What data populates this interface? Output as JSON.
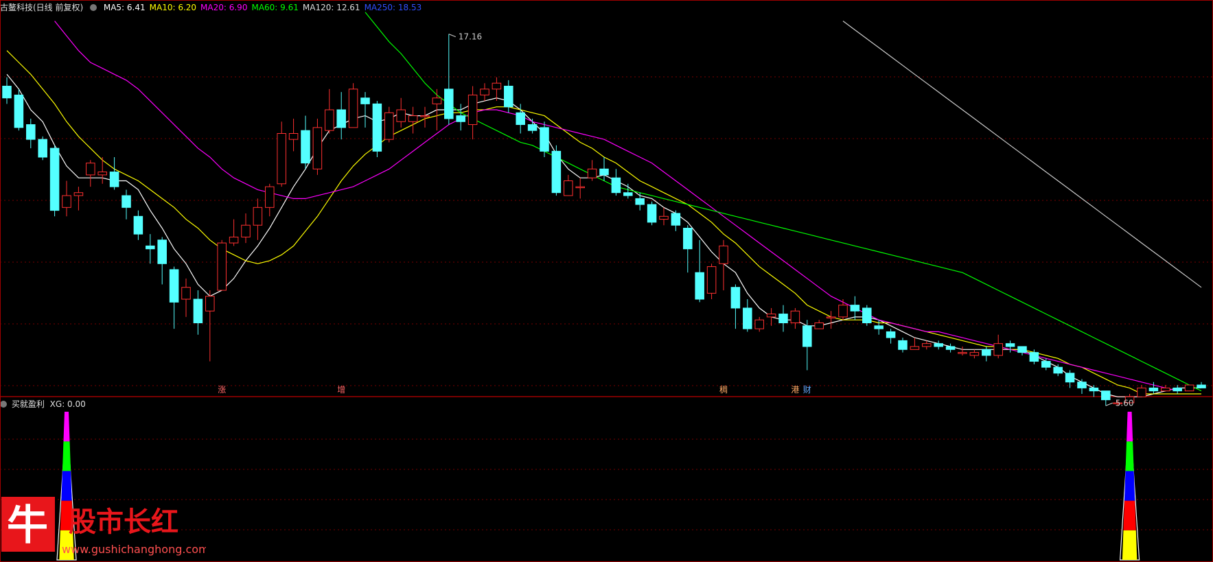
{
  "header": {
    "stock_name": "古鳌科技(日线 前复权)",
    "ma_labels": [
      {
        "text": "MA5: 6.41",
        "color": "#ffffff"
      },
      {
        "text": "MA10: 6.20",
        "color": "#ffff00"
      },
      {
        "text": "MA20: 6.90",
        "color": "#ff00ff"
      },
      {
        "text": "MA60: 9.61",
        "color": "#00ff00"
      },
      {
        "text": "MA120: 12.61",
        "color": "#dddddd"
      },
      {
        "text": "MA250: 18.53",
        "color": "#3050ff"
      }
    ]
  },
  "sub_header": {
    "indicator": "买就盈利",
    "value_label": "XG: 0.00"
  },
  "markers": [
    {
      "text": "涨",
      "x_index": 18,
      "color": "#ff6666"
    },
    {
      "text": "增",
      "x_index": 28,
      "color": "#ff6666"
    },
    {
      "text": "稠",
      "x_index": 60,
      "color": "#ffaa66"
    },
    {
      "text": "港",
      "x_index": 66,
      "color": "#ffaa66"
    },
    {
      "text": "财",
      "x_index": 67,
      "color": "#66aaff"
    }
  ],
  "watermark": {
    "big_char": "牛",
    "title": "股市长红",
    "url": "www.gushichanghong.com"
  },
  "colors": {
    "up": "#ff3030",
    "down": "#54ffff",
    "grid": "#7a0000",
    "border": "#a00000"
  },
  "chart_data": {
    "type": "candlestick",
    "price_max_label": "17.16",
    "price_min_label": "5.60",
    "ylim": [
      5.0,
      17.8
    ],
    "candles": [
      [
        15.4,
        15.0,
        15.7,
        14.8
      ],
      [
        15.1,
        14.0,
        15.3,
        13.9
      ],
      [
        14.1,
        13.6,
        14.3,
        13.3
      ],
      [
        13.6,
        13.0,
        13.7,
        12.9
      ],
      [
        13.3,
        11.2,
        13.4,
        11.0
      ],
      [
        11.3,
        11.7,
        12.2,
        11.0
      ],
      [
        11.7,
        11.8,
        12.0,
        11.2
      ],
      [
        12.4,
        12.8,
        12.9,
        12.0
      ],
      [
        12.4,
        12.5,
        13.0,
        12.1
      ],
      [
        12.5,
        12.0,
        13.0,
        11.9
      ],
      [
        11.7,
        11.3,
        11.9,
        10.9
      ],
      [
        11.0,
        10.4,
        11.2,
        10.2
      ],
      [
        10.0,
        9.9,
        10.4,
        9.4
      ],
      [
        10.2,
        9.4,
        10.3,
        8.7
      ],
      [
        9.2,
        8.1,
        9.3,
        7.2
      ],
      [
        8.2,
        8.6,
        8.9,
        7.6
      ],
      [
        8.2,
        7.4,
        8.5,
        7.0
      ],
      [
        7.8,
        8.3,
        8.5,
        6.1
      ],
      [
        8.5,
        10.1,
        10.2,
        8.5
      ],
      [
        10.1,
        10.3,
        10.9,
        10.0
      ],
      [
        10.3,
        10.7,
        11.1,
        10.1
      ],
      [
        10.7,
        11.3,
        11.6,
        10.2
      ],
      [
        11.3,
        12.0,
        12.1,
        11.0
      ],
      [
        12.1,
        13.8,
        14.2,
        12.0
      ],
      [
        13.6,
        13.8,
        14.3,
        13.2
      ],
      [
        13.9,
        12.8,
        14.4,
        12.6
      ],
      [
        12.6,
        14.0,
        14.3,
        12.4
      ],
      [
        13.9,
        14.6,
        15.3,
        13.8
      ],
      [
        14.6,
        14.0,
        15.2,
        13.6
      ],
      [
        14.0,
        15.3,
        15.5,
        14.0
      ],
      [
        15.0,
        14.8,
        15.2,
        14.0
      ],
      [
        14.8,
        13.2,
        14.9,
        13.0
      ],
      [
        13.6,
        14.5,
        14.7,
        13.5
      ],
      [
        14.2,
        14.6,
        15.0,
        14.0
      ],
      [
        14.2,
        14.4,
        14.7,
        13.8
      ],
      [
        14.4,
        14.4,
        14.7,
        14.0
      ],
      [
        14.8,
        15.0,
        15.3,
        13.9
      ],
      [
        15.3,
        14.3,
        17.16,
        14.1
      ],
      [
        14.4,
        14.2,
        14.8,
        13.9
      ],
      [
        14.1,
        15.1,
        15.4,
        13.6
      ],
      [
        15.1,
        15.3,
        15.5,
        14.9
      ],
      [
        15.3,
        15.5,
        15.7,
        14.9
      ],
      [
        15.4,
        14.7,
        15.6,
        14.5
      ],
      [
        14.5,
        14.1,
        14.8,
        13.8
      ],
      [
        14.1,
        13.9,
        14.3,
        13.8
      ],
      [
        14.0,
        13.2,
        14.2,
        13.0
      ],
      [
        13.2,
        11.8,
        13.4,
        11.7
      ],
      [
        11.7,
        12.2,
        12.4,
        11.7
      ],
      [
        12.0,
        12.0,
        12.3,
        11.6
      ],
      [
        12.3,
        12.6,
        12.9,
        12.2
      ],
      [
        12.6,
        12.4,
        13.0,
        12.2
      ],
      [
        12.3,
        11.8,
        12.6,
        11.7
      ],
      [
        11.8,
        11.7,
        12.1,
        11.6
      ],
      [
        11.6,
        11.4,
        11.8,
        11.2
      ],
      [
        11.4,
        10.8,
        11.5,
        10.7
      ],
      [
        10.9,
        11.0,
        11.3,
        10.7
      ],
      [
        11.1,
        10.7,
        11.2,
        10.5
      ],
      [
        10.6,
        9.9,
        10.7,
        9.1
      ],
      [
        9.1,
        8.2,
        10.2,
        8.1
      ],
      [
        8.4,
        9.3,
        9.4,
        8.2
      ],
      [
        9.4,
        10.0,
        10.2,
        8.5
      ],
      [
        8.6,
        7.9,
        8.7,
        7.2
      ],
      [
        7.9,
        7.2,
        8.2,
        7.1
      ],
      [
        7.2,
        7.5,
        7.6,
        7.1
      ],
      [
        7.6,
        7.7,
        7.9,
        7.3
      ],
      [
        7.7,
        7.4,
        8.0,
        7.1
      ],
      [
        7.4,
        7.8,
        7.9,
        7.2
      ],
      [
        7.3,
        6.6,
        7.5,
        5.8
      ],
      [
        7.2,
        7.4,
        7.5,
        7.2
      ],
      [
        7.6,
        7.6,
        7.8,
        7.2
      ],
      [
        7.6,
        8.0,
        8.2,
        7.5
      ],
      [
        8.0,
        7.8,
        8.3,
        7.5
      ],
      [
        7.9,
        7.4,
        8.0,
        7.3
      ],
      [
        7.3,
        7.2,
        7.5,
        7.0
      ],
      [
        7.1,
        6.9,
        7.2,
        6.7
      ],
      [
        6.8,
        6.5,
        6.9,
        6.4
      ],
      [
        6.5,
        6.6,
        6.9,
        6.5
      ],
      [
        6.6,
        6.7,
        6.8,
        6.5
      ],
      [
        6.7,
        6.6,
        6.8,
        6.5
      ],
      [
        6.6,
        6.5,
        6.7,
        6.4
      ],
      [
        6.4,
        6.4,
        6.6,
        6.3
      ],
      [
        6.3,
        6.4,
        6.5,
        6.2
      ],
      [
        6.5,
        6.3,
        6.6,
        6.1
      ],
      [
        6.3,
        6.7,
        7.0,
        6.2
      ],
      [
        6.7,
        6.6,
        6.8,
        6.4
      ],
      [
        6.6,
        6.4,
        6.6,
        6.3
      ],
      [
        6.4,
        6.1,
        6.5,
        6.0
      ],
      [
        6.1,
        5.9,
        6.2,
        5.8
      ],
      [
        5.9,
        5.7,
        6.0,
        5.6
      ],
      [
        5.7,
        5.4,
        5.8,
        5.2
      ],
      [
        5.4,
        5.2,
        5.5,
        5.0
      ],
      [
        5.2,
        5.1,
        5.3,
        4.9
      ],
      [
        5.1,
        4.8,
        5.1,
        4.6
      ],
      [
        4.7,
        4.7,
        4.8,
        4.6
      ],
      [
        4.7,
        4.9,
        5.0,
        4.7
      ],
      [
        4.9,
        5.2,
        5.3,
        4.9
      ],
      [
        5.2,
        5.1,
        5.4,
        5.0
      ],
      [
        5.1,
        5.2,
        5.3,
        5.1
      ],
      [
        5.2,
        5.1,
        5.3,
        5.0
      ],
      [
        5.1,
        5.3,
        5.3,
        5.1
      ],
      [
        5.3,
        5.2,
        5.4,
        5.2
      ]
    ],
    "series": [
      {
        "name": "MA5",
        "color": "#ffffff",
        "from": 0,
        "values": [
          15.8,
          15.3,
          14.6,
          14.2,
          13.4,
          12.7,
          12.3,
          12.3,
          12.3,
          12.2,
          12.2,
          11.9,
          11.2,
          10.6,
          9.9,
          9.4,
          8.7,
          8.3,
          8.5,
          8.9,
          9.5,
          10.0,
          10.6,
          11.3,
          12.0,
          12.6,
          13.3,
          13.9,
          14.1,
          14.3,
          14.4,
          14.2,
          14.3,
          14.5,
          14.4,
          14.4,
          14.6,
          14.6,
          14.6,
          14.8,
          14.9,
          15.0,
          14.9,
          14.6,
          14.2,
          13.8,
          13.1,
          12.6,
          12.3,
          12.3,
          12.4,
          12.2,
          12.0,
          11.7,
          11.6,
          11.3,
          11.1,
          10.8,
          10.3,
          9.8,
          9.4,
          9.1,
          8.4,
          7.9,
          7.6,
          7.5,
          7.5,
          7.3,
          7.3,
          7.4,
          7.5,
          7.6,
          7.6,
          7.5,
          7.3,
          7.1,
          6.9,
          6.8,
          6.7,
          6.6,
          6.5,
          6.5,
          6.5,
          6.5,
          6.5,
          6.5,
          6.3,
          6.1,
          5.9,
          5.6,
          5.4,
          5.2,
          5.0,
          4.9,
          4.9,
          4.9,
          5.0,
          5.1,
          5.2,
          5.2,
          5.2
        ]
      },
      {
        "name": "MA10",
        "color": "#ffff00",
        "from": 0,
        "values": [
          16.6,
          16.2,
          15.8,
          15.3,
          14.8,
          14.2,
          13.7,
          13.3,
          12.9,
          12.6,
          12.4,
          12.2,
          11.9,
          11.6,
          11.3,
          10.9,
          10.6,
          10.2,
          9.9,
          9.7,
          9.5,
          9.4,
          9.5,
          9.7,
          10.0,
          10.5,
          11.0,
          11.6,
          12.2,
          12.7,
          13.1,
          13.4,
          13.7,
          13.9,
          14.1,
          14.3,
          14.4,
          14.5,
          14.5,
          14.6,
          14.6,
          14.7,
          14.7,
          14.6,
          14.5,
          14.4,
          14.1,
          13.8,
          13.5,
          13.3,
          13.0,
          12.8,
          12.5,
          12.2,
          12.0,
          11.8,
          11.6,
          11.4,
          11.1,
          10.8,
          10.4,
          10.1,
          9.7,
          9.3,
          9.0,
          8.7,
          8.4,
          8.0,
          7.8,
          7.6,
          7.5,
          7.5,
          7.5,
          7.4,
          7.4,
          7.3,
          7.2,
          7.1,
          7.0,
          6.9,
          6.8,
          6.7,
          6.6,
          6.6,
          6.5,
          6.5,
          6.4,
          6.3,
          6.2,
          6.0,
          5.9,
          5.7,
          5.5,
          5.3,
          5.2,
          5.0,
          5.0,
          5.0,
          5.0,
          5.0,
          5.0
        ]
      },
      {
        "name": "MA20",
        "color": "#ff00ff",
        "from": 4,
        "values": [
          17.6,
          17.1,
          16.6,
          16.2,
          16.0,
          15.8,
          15.6,
          15.3,
          14.9,
          14.5,
          14.1,
          13.7,
          13.3,
          13.0,
          12.6,
          12.3,
          12.1,
          11.9,
          11.8,
          11.7,
          11.6,
          11.6,
          11.7,
          11.8,
          11.9,
          12.0,
          12.2,
          12.4,
          12.6,
          12.9,
          13.2,
          13.5,
          13.8,
          14.1,
          14.3,
          14.5,
          14.6,
          14.6,
          14.5,
          14.4,
          14.2,
          14.1,
          14.0,
          13.9,
          13.8,
          13.7,
          13.6,
          13.4,
          13.2,
          13.0,
          12.8,
          12.5,
          12.2,
          11.9,
          11.6,
          11.3,
          11.0,
          10.7,
          10.4,
          10.1,
          9.8,
          9.5,
          9.2,
          8.9,
          8.6,
          8.3,
          8.1,
          7.9,
          7.7,
          7.5,
          7.4,
          7.3,
          7.2,
          7.1,
          7.1,
          7.0,
          6.9,
          6.8,
          6.7,
          6.6,
          6.5,
          6.4,
          6.3,
          6.2,
          6.1,
          6.0,
          5.9,
          5.8,
          5.7,
          5.6,
          5.5,
          5.4,
          5.3,
          5.2,
          5.1
        ]
      },
      {
        "name": "MA60",
        "color": "#00ff00",
        "from": 30,
        "values": [
          17.9,
          17.4,
          16.9,
          16.5,
          16.0,
          15.5,
          15.1,
          14.8,
          14.5,
          14.3,
          14.1,
          13.9,
          13.7,
          13.5,
          13.4,
          13.2,
          13.0,
          12.8,
          12.6,
          12.4,
          12.2,
          12.0,
          11.9,
          11.8,
          11.7,
          11.6,
          11.5,
          11.4,
          11.3,
          11.2,
          11.1,
          11.0,
          10.9,
          10.8,
          10.7,
          10.6,
          10.5,
          10.4,
          10.3,
          10.2,
          10.1,
          10.0,
          9.9,
          9.8,
          9.7,
          9.6,
          9.5,
          9.4,
          9.3,
          9.2,
          9.1,
          8.9,
          8.7,
          8.5,
          8.3,
          8.1,
          7.9,
          7.7,
          7.5,
          7.3,
          7.1,
          6.9,
          6.7,
          6.5,
          6.3,
          6.1,
          5.9,
          5.7,
          5.5,
          5.3,
          5.1
        ]
      },
      {
        "name": "MA120",
        "color": "#cccccc",
        "from": 70,
        "values": [
          17.6,
          17.3,
          17.0,
          16.7,
          16.4,
          16.1,
          15.8,
          15.5,
          15.2,
          14.9,
          14.6,
          14.3,
          14.0,
          13.7,
          13.4,
          13.1,
          12.8,
          12.5,
          12.2,
          11.9,
          11.6,
          11.3,
          11.0,
          10.7,
          10.4,
          10.1,
          9.8,
          9.5,
          9.2,
          8.9,
          8.6
        ]
      }
    ],
    "signal": {
      "name": "XG",
      "value": 0.0,
      "peak_indices": [
        5,
        94
      ],
      "segment_colors": [
        "#ffff00",
        "#ff0000",
        "#0000ff",
        "#00ff00",
        "#ff00ff"
      ]
    }
  }
}
